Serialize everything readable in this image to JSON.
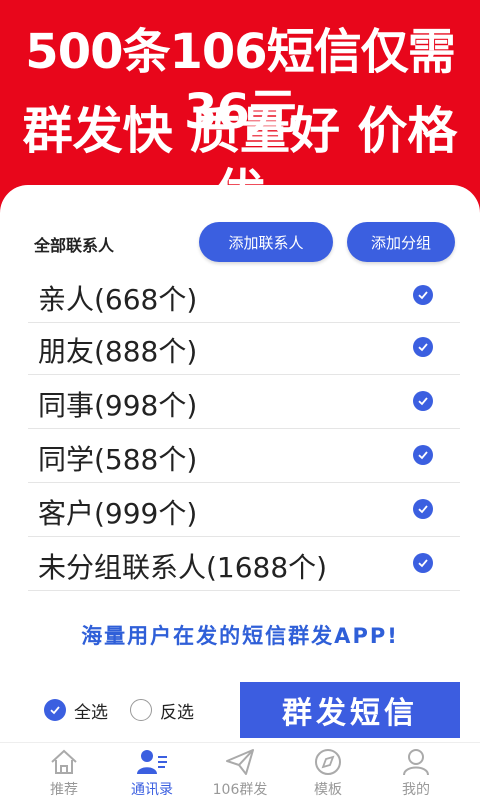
{
  "promo": {
    "line1": "500条106短信仅需36元",
    "line2": "群发快 质量好 价格优"
  },
  "header": {
    "label": "全部联系人",
    "add_contact": "添加联系人",
    "add_group": "添加分组"
  },
  "groups": [
    {
      "label": "亲人(668个)",
      "checked": true
    },
    {
      "label": "朋友(888个)",
      "checked": true
    },
    {
      "label": "同事(998个)",
      "checked": true
    },
    {
      "label": "同学(588个)",
      "checked": true
    },
    {
      "label": "客户(999个)",
      "checked": true
    },
    {
      "label": "未分组联系人(1688个)",
      "checked": true
    }
  ],
  "slogan": "海量用户在发的短信群发APP!",
  "footer": {
    "select_all": "全选",
    "invert": "反选",
    "send": "群发短信"
  },
  "tabs": [
    {
      "label": "推荐",
      "icon": "home-icon"
    },
    {
      "label": "通讯录",
      "icon": "contacts-icon"
    },
    {
      "label": "106群发",
      "icon": "send-icon"
    },
    {
      "label": "模板",
      "icon": "compass-icon"
    },
    {
      "label": "我的",
      "icon": "user-icon"
    }
  ],
  "active_tab": 1,
  "colors": {
    "brand_red": "#e8061b",
    "accent_blue": "#3b5fe0"
  }
}
